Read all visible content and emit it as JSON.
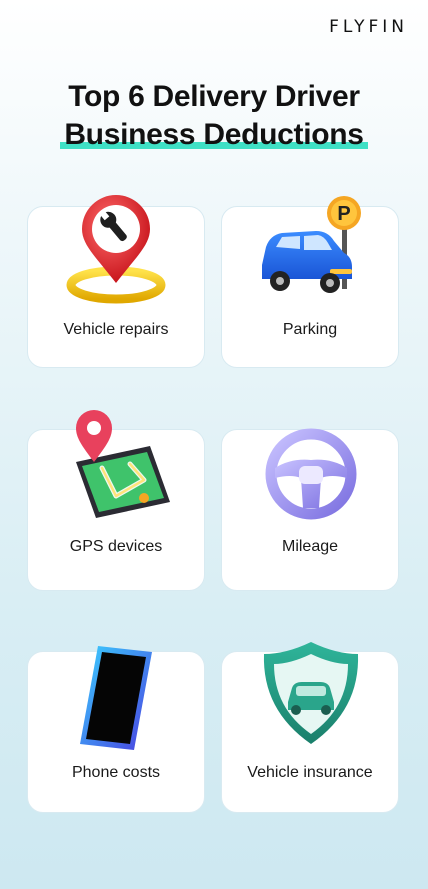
{
  "brand": {
    "logo_text": "FLYFIN"
  },
  "header": {
    "title_line1": "Top 6 Delivery Driver",
    "title_line2": "Business Deductions",
    "highlight_color": "#3fe0c5"
  },
  "cards": [
    {
      "label": "Vehicle repairs",
      "icon": "wrench-location-pin-icon"
    },
    {
      "label": "Parking",
      "icon": "car-parking-sign-icon"
    },
    {
      "label": "GPS devices",
      "icon": "gps-tablet-map-icon"
    },
    {
      "label": "Mileage",
      "icon": "steering-wheel-icon"
    },
    {
      "label": "Phone costs",
      "icon": "smartphone-icon"
    },
    {
      "label": "Vehicle insurance",
      "icon": "car-shield-icon"
    }
  ]
}
